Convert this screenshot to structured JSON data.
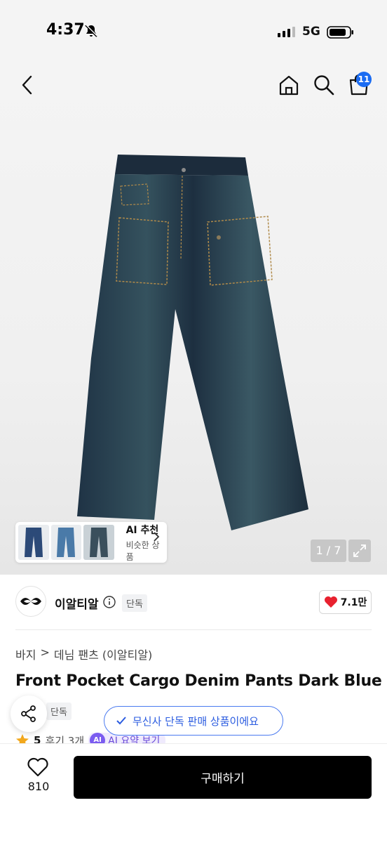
{
  "status_bar": {
    "time": "4:37",
    "network": "5G"
  },
  "header": {
    "cart_count": "11"
  },
  "ai_recommend": {
    "title": "AI 추천",
    "subtitle": "비슷한 상품"
  },
  "gallery": {
    "page_indicator": "1 / 7"
  },
  "brand": {
    "name": "이알티알",
    "exclusive_badge": "단독",
    "likes": "7.1만"
  },
  "breadcrumb": {
    "category": "바지",
    "separator": ">",
    "subcategory": "데님 팬츠 (이알티알)"
  },
  "product": {
    "title": "Front Pocket Cargo Denim Pants Dark Blue",
    "badge": "단독"
  },
  "toast": {
    "text": "무신사 단독 판매 상품이에요"
  },
  "rating": {
    "score": "5",
    "reviews": "후기 3개",
    "ai_badge": "AI",
    "ai_summary": "AI 요약 보기"
  },
  "bottom_bar": {
    "like_count": "810",
    "buy_label": "구매하기"
  },
  "colors": {
    "accent_blue": "#1b6cf2",
    "buy_button": "#000000",
    "heart_red": "#e8212f",
    "ai_purple": "#7b5cf0"
  }
}
